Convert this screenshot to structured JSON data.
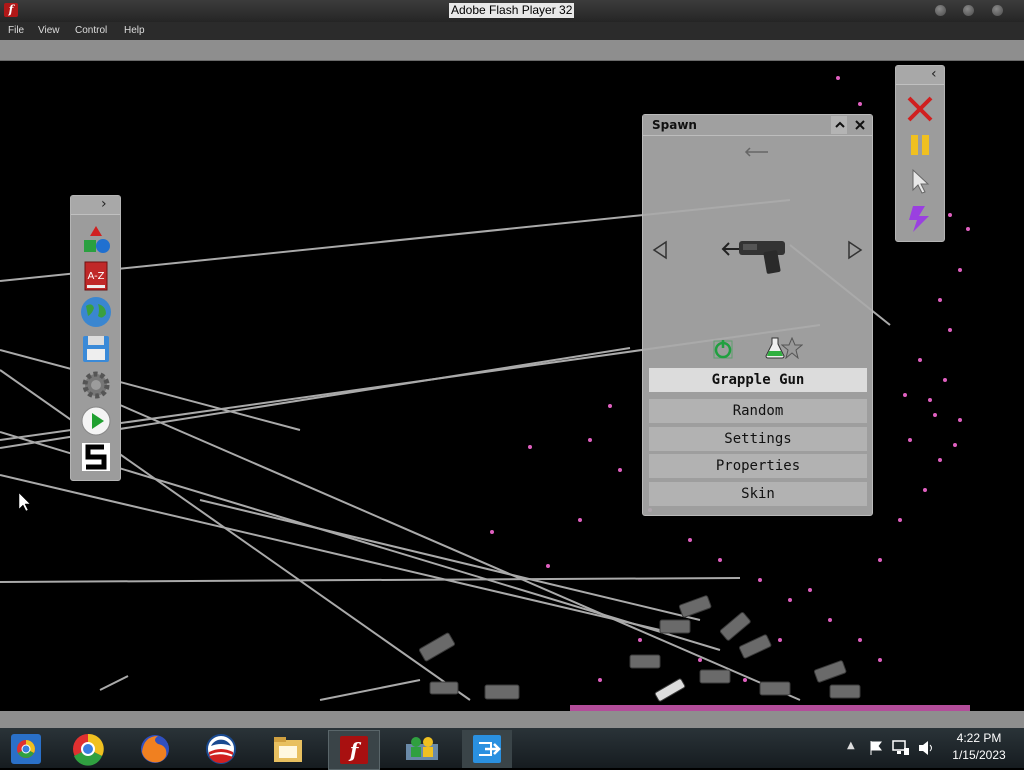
{
  "window": {
    "title": "Adobe Flash Player 32"
  },
  "menubar": {
    "items": [
      "File",
      "View",
      "Control",
      "Help"
    ]
  },
  "left_toolbar": {
    "icons": [
      "shapes-icon",
      "a-z-book-icon",
      "globe-icon",
      "save-disk-icon",
      "settings-gear-icon",
      "play-icon",
      "s-logo-icon"
    ],
    "book_label": "A-Z"
  },
  "right_toolbar": {
    "icons": [
      "close-x-icon",
      "pause-icon",
      "cursor-icon",
      "lightning-icon"
    ]
  },
  "spawn_panel": {
    "title": "Spawn",
    "selected_item": "Grapple Gun",
    "menu": [
      "Random",
      "Settings",
      "Properties",
      "Skin"
    ]
  },
  "taskbar": {
    "apps": [
      "chrome-remote-icon",
      "chrome-icon",
      "firefox-icon",
      "obama-logo-icon",
      "file-explorer-icon",
      "flash-icon",
      "network-people-icon",
      "exit-app-icon"
    ],
    "active_app": "flash-icon",
    "clock": {
      "time": "4:22 PM",
      "date": "1/15/2023"
    }
  },
  "colors": {
    "particles": "#e060c0",
    "panel": "#aaaaaa",
    "taskbar": "#1c2327"
  }
}
